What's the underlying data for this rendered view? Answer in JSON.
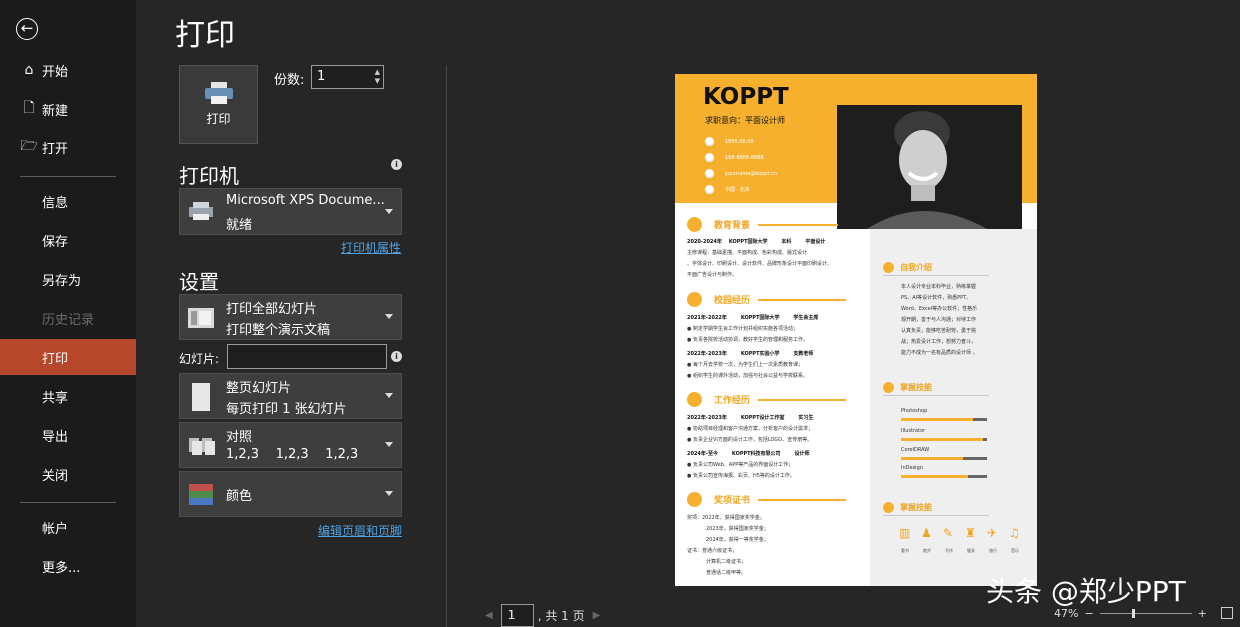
{
  "sidebar": {
    "back_icon": "arrow-left-icon",
    "items": [
      {
        "label": "开始",
        "icon": "home-icon"
      },
      {
        "label": "新建",
        "icon": "new-file-icon"
      },
      {
        "label": "打开",
        "icon": "open-folder-icon"
      },
      {
        "label": "信息"
      },
      {
        "label": "保存"
      },
      {
        "label": "另存为"
      },
      {
        "label": "历史记录"
      },
      {
        "label": "打印"
      },
      {
        "label": "共享"
      },
      {
        "label": "导出"
      },
      {
        "label": "关闭"
      },
      {
        "label": "帐户"
      },
      {
        "label": "更多..."
      }
    ],
    "active_color": "#b7472a"
  },
  "main": {
    "title": "打印",
    "print_button": "打印",
    "copies_label": "份数:",
    "copies_value": "1",
    "printer_section": "打印机",
    "printer_name": "Microsoft XPS Docume...",
    "printer_status": "就绪",
    "printer_props_link": "打印机属性",
    "settings_section": "设置",
    "range_line1": "打印全部幻灯片",
    "range_line2": "打印整个演示文稿",
    "slides_label": "幻灯片:",
    "slides_value": "",
    "layout_line1": "整页幻灯片",
    "layout_line2": "每页打印 1 张幻灯片",
    "collate_line1": "对照",
    "collate_line2": "1,2,3    1,2,3    1,2,3",
    "color_label": "颜色",
    "header_footer_link": "编辑页眉和页脚"
  },
  "preview": {
    "name": "KOPPT",
    "job": "求职意向：平面设计师",
    "contacts": [
      "1995.08.08",
      "188-8888-8888",
      "yourname@koppt.cn",
      "中国 · 北京"
    ],
    "edu": {
      "heading": "教育背景",
      "row1": "2020-2024年    KOPPT国际大学        本科        平面设计",
      "l1": "主修课程：基础素描、平面构成、色彩构成、版式设计",
      "l2": "、字体设计、印刷设计、设计软件、品牌形象设计平面印刷设计、",
      "l3": "平面广告设计与制作。"
    },
    "campus": {
      "heading": "校园经历",
      "row1": "2021年-2022年        KOPPT国际大学        学生会主席",
      "b1": "● 制定学期学生会工作计划并组织实施各项活动；",
      "b2": "● 负责各院校活动协调，教好学生的管理和服务工作。",
      "row2": "2022年-2023年        KOPPT实验小学        支教老师",
      "b3": "● 每个月去学校一次，为学生们上一次素质教育课；",
      "b4": "● 组织学生的课外活动，加强与社会公益与学校联系。"
    },
    "work": {
      "heading": "工作经历",
      "row1": "2022年-2023年        KOPPT设计工作室        实习生",
      "b1": "● 协助项目经理和客户沟通方案，分析客户的设计需求；",
      "b2": "● 负责企业VI方面的设计工作，包括LOGO、宣传册等。",
      "row2": "2024年-至今        KOPPT科技有限公司        设计师",
      "b3": "● 负责公司Web、APP等产品的界面设计工作；",
      "b4": "● 负责公司宣传海报、彩页、H5等的设计工作。"
    },
    "cert": {
      "heading": "奖项证书",
      "l1": "奖项：2022年，获得国家奖学金；",
      "l2": "2023年，获得国家奖学金；",
      "l3": "2024年，获得一等奖学金；",
      "l4": "证书：普通六级证书；",
      "l5": "计算机二级证书；",
      "l6": "普通话二级甲等。"
    },
    "about": {
      "heading": "自我介绍",
      "l1": "本人设计专业本科毕业，熟练掌握",
      "l2": "PS、AI等设计软件，熟悉PPT、",
      "l3": "Word、Excel等办公软件；性格乐",
      "l4": "观开朗，善于与人沟通；对待工作",
      "l5": "认真负责，能够吃苦耐劳，勇于挑",
      "l6": "战；热爱设计工作，想努力奋斗，",
      "l7": "能力不成为一名有品质的设计师 。"
    },
    "skills": {
      "heading": "掌握技能",
      "items": [
        {
          "name": "Photoshop",
          "level": 0.84
        },
        {
          "name": "Illustrator",
          "level": 0.95
        },
        {
          "name": "CorelDRAW",
          "level": 0.72
        },
        {
          "name": "InDesign",
          "level": 0.78
        }
      ]
    },
    "hobbies": {
      "heading": "掌握技能",
      "items": [
        {
          "label": "看书",
          "icon": "book-icon"
        },
        {
          "label": "跑步",
          "icon": "running-icon"
        },
        {
          "label": "写作",
          "icon": "pen-icon"
        },
        {
          "label": "健身",
          "icon": "fitness-icon"
        },
        {
          "label": "旅行",
          "icon": "plane-icon"
        },
        {
          "label": "音乐",
          "icon": "music-icon"
        }
      ]
    },
    "accent": "#f6b02e"
  },
  "footer": {
    "page_value": "1",
    "page_total": ", 共 1 页",
    "zoom": "47%",
    "watermark": "头条 @郑少PPT"
  }
}
